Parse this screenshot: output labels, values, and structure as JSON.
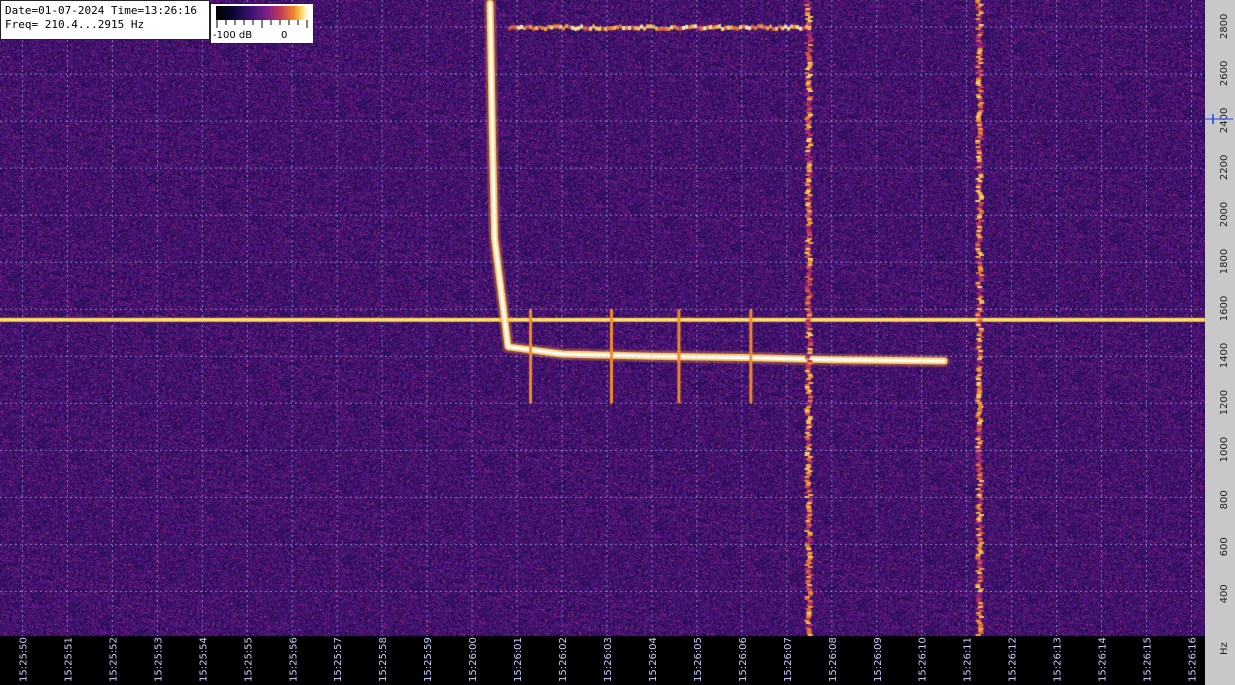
{
  "info": {
    "date_time": "Date=01-07-2024 Time=13:26:16",
    "freq": "Freq= 210.4...2915 Hz"
  },
  "scale": {
    "min_label": "-100 dB",
    "max_label": "0"
  },
  "chart_data": {
    "type": "heatmap",
    "title": "",
    "xlabel": "",
    "ylabel": "Hz",
    "x_ticks": [
      "15:25:50",
      "15:25:51",
      "15:25:52",
      "15:25:53",
      "15:25:54",
      "15:25:55",
      "15:25:56",
      "15:25:57",
      "15:25:58",
      "15:25:59",
      "15:26:00",
      "15:26:01",
      "15:26:02",
      "15:26:03",
      "15:26:04",
      "15:26:05",
      "15:26:06",
      "15:26:07",
      "15:26:08",
      "15:26:09",
      "15:26:10",
      "15:26:11",
      "15:26:12",
      "15:26:13",
      "15:26:14",
      "15:26:15",
      "15:26:16"
    ],
    "y_ticks": [
      400,
      600,
      800,
      1000,
      1200,
      1400,
      1600,
      1800,
      2000,
      2200,
      2400,
      2600,
      2800
    ],
    "y_unit": "Hz",
    "ylim": [
      210.4,
      2915
    ],
    "xlim": [
      "15:25:49.5",
      "15:26:16.3"
    ],
    "color_scale_db": [
      -100,
      0
    ],
    "colormap": [
      "#000000",
      "#0b0630",
      "#3b1273",
      "#7a1c8a",
      "#c23a5a",
      "#f08a2a",
      "#ffe070",
      "#ffffff"
    ],
    "features": [
      {
        "name": "carrier",
        "type": "horizontal_line",
        "freq_hz": 1555,
        "from": "15:25:49.5",
        "to": "15:26:16.3"
      },
      {
        "name": "meteor-trail",
        "type": "curve",
        "points": [
          [
            "15:26:00.4",
            2900
          ],
          [
            "15:26:00.45",
            2350
          ],
          [
            "15:26:00.5",
            1900
          ],
          [
            "15:26:00.8",
            1440
          ],
          [
            "15:26:02",
            1410
          ],
          [
            "15:26:04",
            1400
          ],
          [
            "15:26:06",
            1395
          ],
          [
            "15:26:08",
            1385
          ],
          [
            "15:26:10.5",
            1380
          ]
        ]
      },
      {
        "name": "burst-spikes",
        "type": "vertical_segments",
        "times": [
          "15:26:01.3",
          "15:26:03.1",
          "15:26:04.6",
          "15:26:06.2"
        ],
        "freq_range_hz": [
          1200,
          1600
        ]
      },
      {
        "name": "broadband-bands",
        "type": "vertical_bands",
        "times": [
          "15:26:07.5",
          "15:26:11.3"
        ]
      },
      {
        "name": "upper-echo",
        "type": "horizontal_segment",
        "freq_hz": 2800,
        "from": "15:26:00.8",
        "to": "15:26:07.5"
      }
    ]
  }
}
